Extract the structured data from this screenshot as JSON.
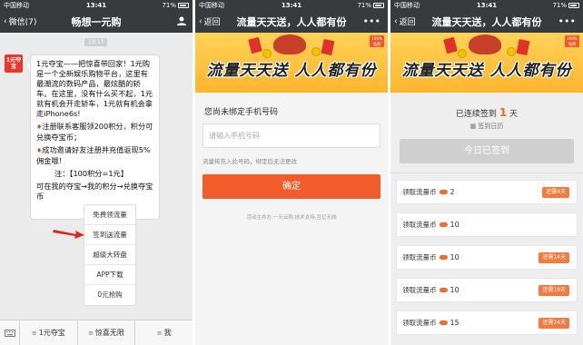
{
  "status": {
    "carrier": "中国移动",
    "time": "13:41",
    "battery": "71%"
  },
  "screen1": {
    "back_label": "微信(7)",
    "title": "畅想一元购",
    "timestamp": "13:17",
    "avatar_text": "1元夺宝",
    "message": {
      "intro": "1元夺宝——把惊喜带回家！1元购是一个全新娱乐购物平台，这里有最潮流的数码产品，最炫酷的轿车。在这里，没有什么买不起，1元就有机会开走轿车，1元就有机会拿走iPhone6s!",
      "line1": "注册联系客服领200积分，积分可兑换夺宝币；",
      "line2": "成功邀请好友注册并充值返现5%佣金哦！",
      "line3": "注：【100积分=1元】",
      "line4": "可在我的夺宝→我的积分→兑换夺宝币"
    },
    "popup_menu": [
      "免费领流量",
      "签到送流量",
      "超级大转盘",
      "APP下载",
      "0元抢购"
    ],
    "bottom_tabs": [
      "1元夺宝",
      "惊喜无限",
      "我"
    ]
  },
  "screen2": {
    "back_label": "返回",
    "title": "流量天天送，人人都有份",
    "banner_text": "流量天天送  人人都有份",
    "badge_text": "100%\n免费",
    "heading": "您尚未绑定手机号码",
    "phone_placeholder": "请输入手机号码",
    "note": "流量将充入此号码，绑定后无法更改",
    "confirm_label": "确定",
    "footer": "活动主办方:一元云购    技术支持:互亿无线"
  },
  "screen3": {
    "back_label": "返回",
    "title": "流量天天送，人人都有份",
    "banner_text": "流量天天送  人人都有份",
    "badge_text": "100%\n免费",
    "streak_prefix": "已连续签到",
    "streak_count": "1",
    "streak_suffix": "天",
    "calendar_label": "签到日历",
    "done_label": "今日已签到",
    "rewards": [
      {
        "label": "领取流量币",
        "amount": "2",
        "badge": "还需4天"
      },
      {
        "label": "领取流量币",
        "amount": "10",
        "badge": ""
      },
      {
        "label": "领取流量币",
        "amount": "10",
        "badge": "还需14天"
      },
      {
        "label": "领取流量币",
        "amount": "10",
        "badge": "还需19天"
      },
      {
        "label": "领取流量币",
        "amount": "15",
        "badge": "还需24天"
      }
    ]
  }
}
